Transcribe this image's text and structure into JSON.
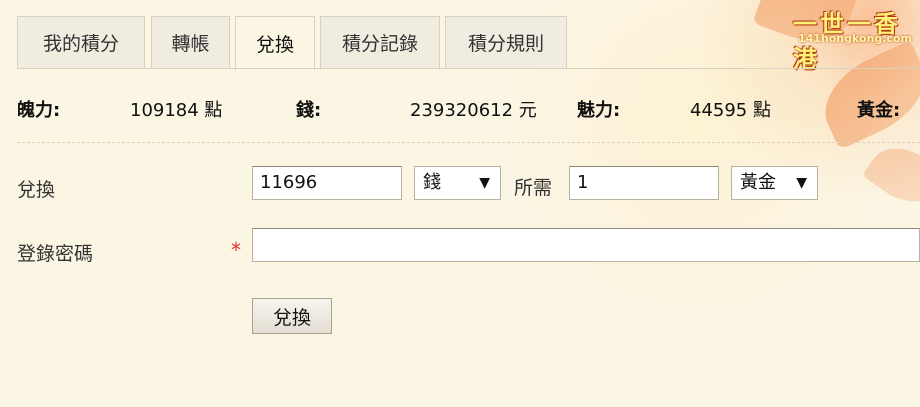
{
  "logo": {
    "text": "一世一香港",
    "subtext": "141hongkong.com"
  },
  "tabs": [
    {
      "label": "我的積分"
    },
    {
      "label": "轉帳"
    },
    {
      "label": "兌換",
      "active": true
    },
    {
      "label": "積分記錄"
    },
    {
      "label": "積分規則"
    }
  ],
  "stats": [
    {
      "label": "魄力:",
      "value": "109184 點"
    },
    {
      "label": "錢:",
      "value": "239320612 元"
    },
    {
      "label": "魅力:",
      "value": "44595 點"
    },
    {
      "label": "黃金:",
      "value": ""
    }
  ],
  "exchange": {
    "label": "兌換",
    "amount_value": "11696",
    "from_currency": "錢",
    "required_label": "所需",
    "required_value": "1",
    "to_currency": "黃金"
  },
  "password": {
    "label": "登錄密碼",
    "required_mark": "*",
    "value": ""
  },
  "submit": {
    "label": "兌換"
  },
  "colors": {
    "accent_required": "#e03030",
    "background": "#fbf5e4",
    "tab_border": "#d7d1c2"
  }
}
